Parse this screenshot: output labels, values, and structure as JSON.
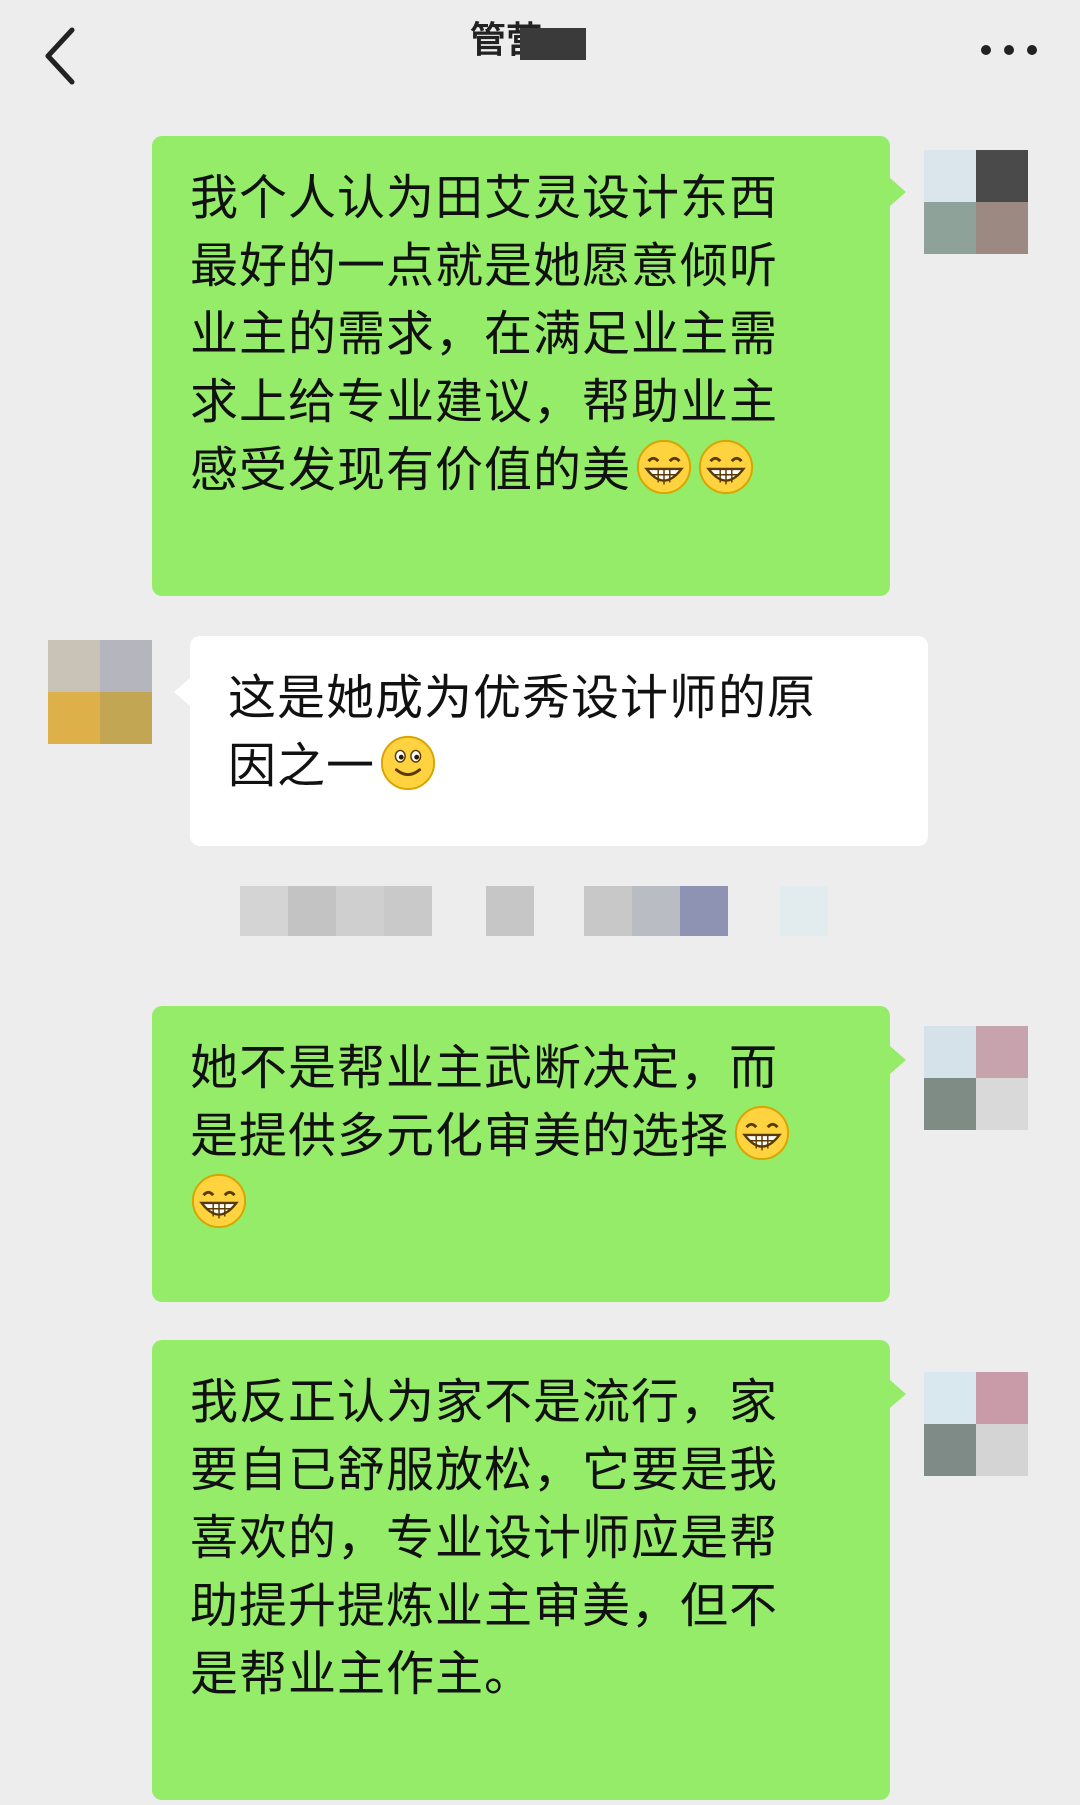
{
  "header": {
    "title": "管营",
    "back_icon": "chevron-left-icon",
    "more_icon": "more-dots-icon"
  },
  "colors": {
    "background": "#ededed",
    "my_bubble": "#95ec69",
    "their_bubble": "#ffffff"
  },
  "messages": [
    {
      "sender": "me",
      "lines": [
        "我个人认为田艾灵设计东西",
        "最好的一点就是她愿意倾听",
        "业主的需求，在满足业主需",
        "求上给专业建议，帮助业主",
        "感受发现有价值的美"
      ],
      "trailing_emoji": [
        "grin-emoji",
        "grin-emoji"
      ]
    },
    {
      "sender": "them",
      "lines": [
        "这是她成为优秀设计师的原",
        "因之一"
      ],
      "trailing_emoji": [
        "smile-emoji"
      ]
    },
    {
      "sender": "me",
      "lines": [
        "她不是帮业主武断决定，而",
        "是提供多元化审美的选择",
        ""
      ],
      "trailing_emoji_line1": [
        "grin-emoji"
      ],
      "trailing_emoji": [
        "grin-emoji"
      ]
    },
    {
      "sender": "me",
      "lines": [
        "我反正认为家不是流行，家",
        "要自已舒服放松，它要是我",
        "喜欢的，专业设计师应是帮",
        "助提升提炼业主审美，但不",
        "是帮业主作主。"
      ]
    }
  ]
}
